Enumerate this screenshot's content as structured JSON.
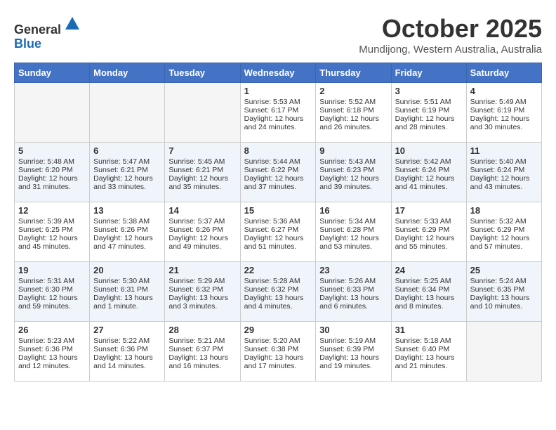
{
  "header": {
    "logo_general": "General",
    "logo_blue": "Blue",
    "month_title": "October 2025",
    "location": "Mundijong, Western Australia, Australia"
  },
  "weekdays": [
    "Sunday",
    "Monday",
    "Tuesday",
    "Wednesday",
    "Thursday",
    "Friday",
    "Saturday"
  ],
  "weeks": [
    [
      {
        "day": "",
        "text": ""
      },
      {
        "day": "",
        "text": ""
      },
      {
        "day": "",
        "text": ""
      },
      {
        "day": "1",
        "text": "Sunrise: 5:53 AM\nSunset: 6:17 PM\nDaylight: 12 hours and 24 minutes."
      },
      {
        "day": "2",
        "text": "Sunrise: 5:52 AM\nSunset: 6:18 PM\nDaylight: 12 hours and 26 minutes."
      },
      {
        "day": "3",
        "text": "Sunrise: 5:51 AM\nSunset: 6:19 PM\nDaylight: 12 hours and 28 minutes."
      },
      {
        "day": "4",
        "text": "Sunrise: 5:49 AM\nSunset: 6:19 PM\nDaylight: 12 hours and 30 minutes."
      }
    ],
    [
      {
        "day": "5",
        "text": "Sunrise: 5:48 AM\nSunset: 6:20 PM\nDaylight: 12 hours and 31 minutes."
      },
      {
        "day": "6",
        "text": "Sunrise: 5:47 AM\nSunset: 6:21 PM\nDaylight: 12 hours and 33 minutes."
      },
      {
        "day": "7",
        "text": "Sunrise: 5:45 AM\nSunset: 6:21 PM\nDaylight: 12 hours and 35 minutes."
      },
      {
        "day": "8",
        "text": "Sunrise: 5:44 AM\nSunset: 6:22 PM\nDaylight: 12 hours and 37 minutes."
      },
      {
        "day": "9",
        "text": "Sunrise: 5:43 AM\nSunset: 6:23 PM\nDaylight: 12 hours and 39 minutes."
      },
      {
        "day": "10",
        "text": "Sunrise: 5:42 AM\nSunset: 6:24 PM\nDaylight: 12 hours and 41 minutes."
      },
      {
        "day": "11",
        "text": "Sunrise: 5:40 AM\nSunset: 6:24 PM\nDaylight: 12 hours and 43 minutes."
      }
    ],
    [
      {
        "day": "12",
        "text": "Sunrise: 5:39 AM\nSunset: 6:25 PM\nDaylight: 12 hours and 45 minutes."
      },
      {
        "day": "13",
        "text": "Sunrise: 5:38 AM\nSunset: 6:26 PM\nDaylight: 12 hours and 47 minutes."
      },
      {
        "day": "14",
        "text": "Sunrise: 5:37 AM\nSunset: 6:26 PM\nDaylight: 12 hours and 49 minutes."
      },
      {
        "day": "15",
        "text": "Sunrise: 5:36 AM\nSunset: 6:27 PM\nDaylight: 12 hours and 51 minutes."
      },
      {
        "day": "16",
        "text": "Sunrise: 5:34 AM\nSunset: 6:28 PM\nDaylight: 12 hours and 53 minutes."
      },
      {
        "day": "17",
        "text": "Sunrise: 5:33 AM\nSunset: 6:29 PM\nDaylight: 12 hours and 55 minutes."
      },
      {
        "day": "18",
        "text": "Sunrise: 5:32 AM\nSunset: 6:29 PM\nDaylight: 12 hours and 57 minutes."
      }
    ],
    [
      {
        "day": "19",
        "text": "Sunrise: 5:31 AM\nSunset: 6:30 PM\nDaylight: 12 hours and 59 minutes."
      },
      {
        "day": "20",
        "text": "Sunrise: 5:30 AM\nSunset: 6:31 PM\nDaylight: 13 hours and 1 minute."
      },
      {
        "day": "21",
        "text": "Sunrise: 5:29 AM\nSunset: 6:32 PM\nDaylight: 13 hours and 3 minutes."
      },
      {
        "day": "22",
        "text": "Sunrise: 5:28 AM\nSunset: 6:32 PM\nDaylight: 13 hours and 4 minutes."
      },
      {
        "day": "23",
        "text": "Sunrise: 5:26 AM\nSunset: 6:33 PM\nDaylight: 13 hours and 6 minutes."
      },
      {
        "day": "24",
        "text": "Sunrise: 5:25 AM\nSunset: 6:34 PM\nDaylight: 13 hours and 8 minutes."
      },
      {
        "day": "25",
        "text": "Sunrise: 5:24 AM\nSunset: 6:35 PM\nDaylight: 13 hours and 10 minutes."
      }
    ],
    [
      {
        "day": "26",
        "text": "Sunrise: 5:23 AM\nSunset: 6:36 PM\nDaylight: 13 hours and 12 minutes."
      },
      {
        "day": "27",
        "text": "Sunrise: 5:22 AM\nSunset: 6:36 PM\nDaylight: 13 hours and 14 minutes."
      },
      {
        "day": "28",
        "text": "Sunrise: 5:21 AM\nSunset: 6:37 PM\nDaylight: 13 hours and 16 minutes."
      },
      {
        "day": "29",
        "text": "Sunrise: 5:20 AM\nSunset: 6:38 PM\nDaylight: 13 hours and 17 minutes."
      },
      {
        "day": "30",
        "text": "Sunrise: 5:19 AM\nSunset: 6:39 PM\nDaylight: 13 hours and 19 minutes."
      },
      {
        "day": "31",
        "text": "Sunrise: 5:18 AM\nSunset: 6:40 PM\nDaylight: 13 hours and 21 minutes."
      },
      {
        "day": "",
        "text": ""
      }
    ]
  ]
}
